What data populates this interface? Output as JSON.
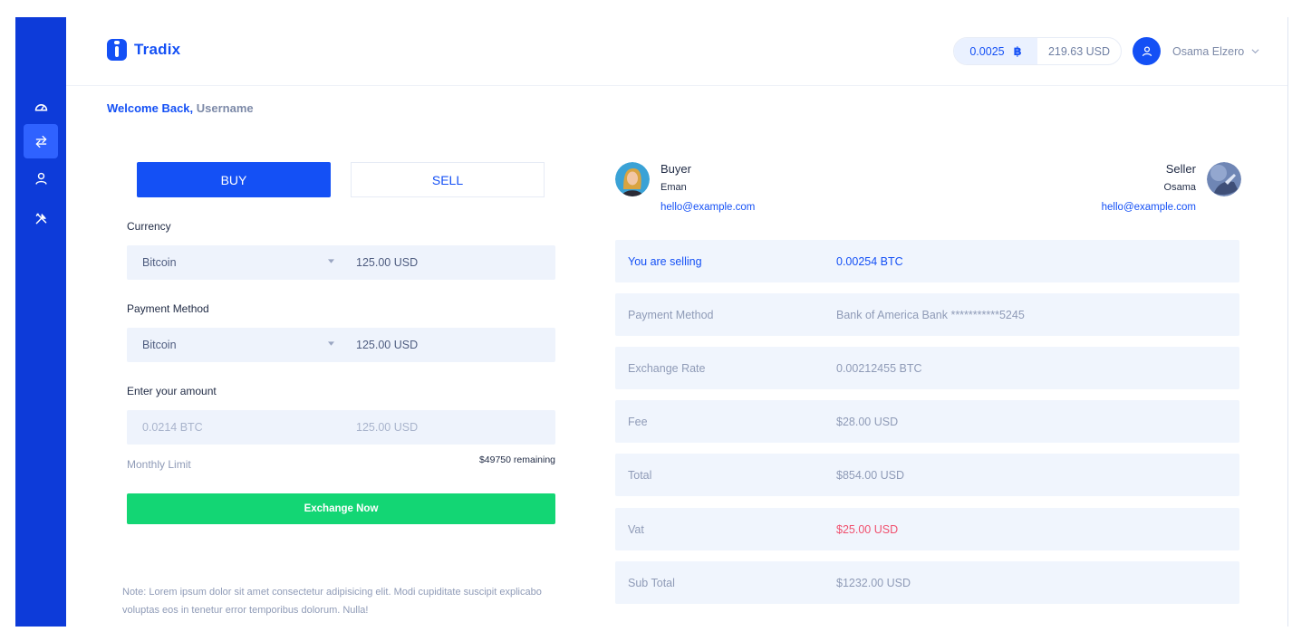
{
  "app": {
    "name": "Tradix"
  },
  "colors": {
    "brand": "#1450f5",
    "sidebar": "#0d3bd9",
    "success": "#13d674",
    "danger": "#f0506e",
    "field_bg": "#eef3fc"
  },
  "sidebar": {
    "items": [
      {
        "icon": "dashboard-icon",
        "active": false
      },
      {
        "icon": "exchange-arrows-icon",
        "active": true
      },
      {
        "icon": "user-icon",
        "active": false
      },
      {
        "icon": "tools-icon",
        "active": false
      }
    ]
  },
  "header": {
    "balance_btc": "0.0025",
    "btc_symbol": "฿",
    "balance_usd": "219.63 USD",
    "user_name": "Osama Elzero"
  },
  "welcome": {
    "prefix": "Welcome Back,",
    "username": "Username"
  },
  "trade": {
    "tabs": {
      "buy": "BUY",
      "sell": "SELL"
    },
    "currency": {
      "label": "Currency",
      "selected": "Bitcoin",
      "amount": "125.00 USD"
    },
    "payment": {
      "label": "Payment Method",
      "selected": "Bitcoin",
      "amount": "125.00 USD"
    },
    "amount": {
      "label": "Enter your amount",
      "btc_placeholder": "0.0214 BTC",
      "usd_placeholder": "125.00 USD"
    },
    "limit": {
      "label": "Monthly Limit",
      "remaining": "$49750 remaining"
    },
    "exchange_button": "Exchange Now",
    "note": "Note: Lorem ipsum dolor sit amet consectetur adipisicing elit. Modi cupiditate suscipit explicabo voluptas eos in tenetur error temporibus dolorum. Nulla!"
  },
  "buyer": {
    "title": "Buyer",
    "name": "Eman",
    "email": "hello@example.com"
  },
  "seller": {
    "title": "Seller",
    "name": "Osama",
    "email": "hello@example.com"
  },
  "summary": {
    "rows": [
      {
        "label": "You are selling",
        "value": "0.00254 BTC"
      },
      {
        "label": "Payment Method",
        "value": "Bank of America Bank ***********5245"
      },
      {
        "label": "Exchange Rate",
        "value": "0.00212455 BTC"
      },
      {
        "label": "Fee",
        "value": "$28.00 USD"
      },
      {
        "label": "Total",
        "value": "$854.00 USD"
      },
      {
        "label": "Vat",
        "value": "$25.00 USD"
      },
      {
        "label": "Sub Total",
        "value": "$1232.00 USD"
      }
    ]
  }
}
